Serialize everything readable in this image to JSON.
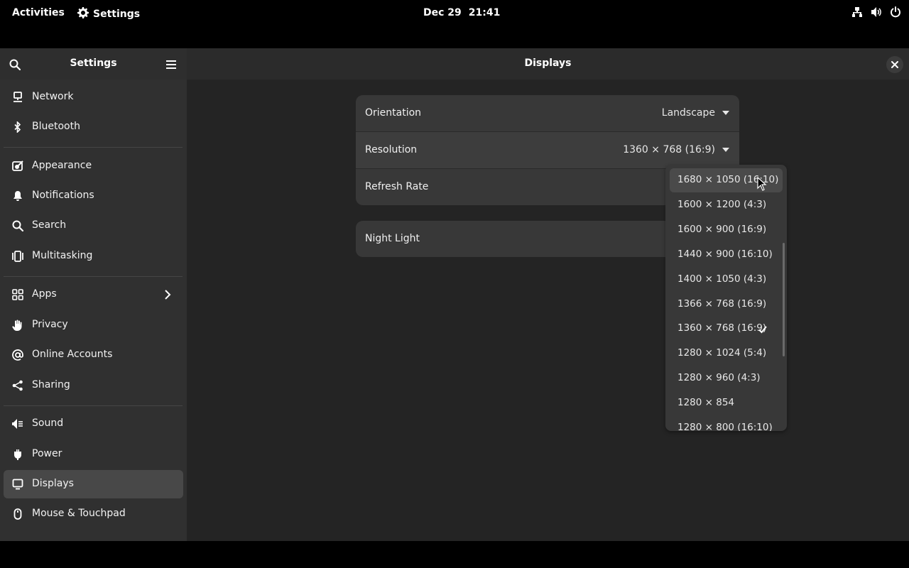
{
  "topbar": {
    "activities": "Activities",
    "app_name": "Settings",
    "date": "Dec 29",
    "time": "21:41",
    "tray_icons": [
      "network-wired-icon",
      "volume-icon",
      "power-icon"
    ]
  },
  "sidebar": {
    "title": "Settings",
    "items": [
      {
        "label": "Network",
        "icon": "network-icon"
      },
      {
        "label": "Bluetooth",
        "icon": "bluetooth-icon"
      },
      {
        "label": "Appearance",
        "icon": "appearance-icon"
      },
      {
        "label": "Notifications",
        "icon": "bell-icon"
      },
      {
        "label": "Search",
        "icon": "search-icon"
      },
      {
        "label": "Multitasking",
        "icon": "multitasking-icon"
      },
      {
        "label": "Apps",
        "icon": "apps-grid-icon"
      },
      {
        "label": "Privacy",
        "icon": "hand-icon"
      },
      {
        "label": "Online Accounts",
        "icon": "at-icon"
      },
      {
        "label": "Sharing",
        "icon": "share-icon"
      },
      {
        "label": "Sound",
        "icon": "speaker-icon"
      },
      {
        "label": "Power",
        "icon": "power-plug-icon"
      },
      {
        "label": "Displays",
        "icon": "display-icon",
        "active": true
      },
      {
        "label": "Mouse & Touchpad",
        "icon": "mouse-icon"
      }
    ]
  },
  "main": {
    "title": "Displays",
    "rows": [
      {
        "label": "Orientation",
        "value": "Landscape"
      },
      {
        "label": "Resolution",
        "value": "1360 × 768 (16:9)"
      },
      {
        "label": "Refresh Rate",
        "value": ""
      }
    ],
    "night_light": {
      "label": "Night Light"
    }
  },
  "resolution_popover": {
    "options": [
      "1680 × 1050 (16:10)",
      "1600 × 1200 (4:3)",
      "1600 × 900 (16:9)",
      "1440 × 900 (16:10)",
      "1400 × 1050 (4:3)",
      "1366 × 768 (16:9)",
      "1360 × 768 (16:9)",
      "1280 × 1024 (5:4)",
      "1280 × 960 (4:3)",
      "1280 × 854",
      "1280 × 800 (16:10)"
    ],
    "selected": "1360 × 768 (16:9)",
    "hovered": "1680 × 1050 (16:10)"
  }
}
